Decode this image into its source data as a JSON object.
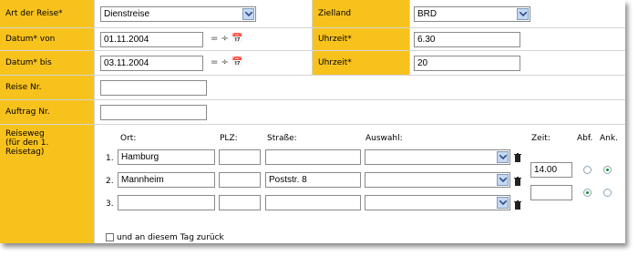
{
  "colors": {
    "label_bg": "#f7c21c",
    "border": "#d4d4d4"
  },
  "rows": {
    "art": {
      "label": "Art der Reise*",
      "value": "Dienstreise"
    },
    "zielland": {
      "label": "Zielland",
      "value": "BRD"
    },
    "datum_von": {
      "label": "Datum* von",
      "value": "01.11.2004"
    },
    "uhrzeit_von": {
      "label": "Uhrzeit*",
      "value": "6.30"
    },
    "datum_bis": {
      "label": "Datum* bis",
      "value": "03.11.2004"
    },
    "uhrzeit_bis": {
      "label": "Uhrzeit*",
      "value": "20"
    },
    "reise_nr": {
      "label": "Reise Nr.",
      "value": ""
    },
    "auftrag_nr": {
      "label": "Auftrag Nr.",
      "value": ""
    }
  },
  "date_icons": "= ÷ 📅",
  "reiseweg": {
    "label_line1": "Reiseweg",
    "label_line2": "(für den 1.",
    "label_line3": "Reisetag)",
    "headers": {
      "ort": "Ort:",
      "plz": "PLZ:",
      "strasse": "Straße:",
      "auswahl": "Auswahl:",
      "zeit": "Zeit:",
      "abf": "Abf.",
      "ank": "Ank."
    },
    "stops": [
      {
        "num": "1.",
        "ort": "Hamburg",
        "plz": "",
        "strasse": "",
        "auswahl": ""
      },
      {
        "num": "2.",
        "ort": "Mannheim",
        "plz": "",
        "strasse": "Poststr. 8",
        "auswahl": ""
      },
      {
        "num": "3.",
        "ort": "",
        "plz": "",
        "strasse": "",
        "auswahl": ""
      }
    ],
    "zeiten": [
      {
        "zeit": "14.00",
        "abf": false,
        "ank": true
      },
      {
        "zeit": "",
        "abf": true,
        "ank": false
      }
    ],
    "return_label": "und an diesem Tag zurück",
    "return_checked": false
  }
}
